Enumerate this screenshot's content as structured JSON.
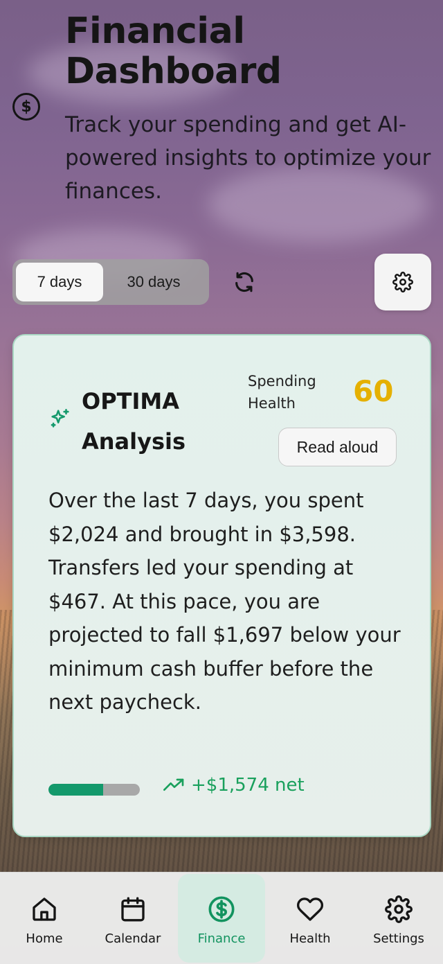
{
  "header": {
    "title": "Financial Dashboard",
    "subtitle": "Track your spending and get AI-powered insights to optimize your finances.",
    "logo_icon": "dollar-circle-icon"
  },
  "controls": {
    "range_options": [
      "7 days",
      "30 days"
    ],
    "selected_range": "7 days",
    "refresh_icon": "refresh-icon",
    "settings_icon": "gear-icon"
  },
  "analysis": {
    "icon": "sparkles-icon",
    "title": "OPTIMA Analysis",
    "health_label": "Spending Health",
    "health_score": "60",
    "read_aloud_label": "Read aloud",
    "text": "Over the last 7 days, you spent $2,024 and brought in $3,598. Transfers led your spending at $467. At this pace, you are projected to fall $1,697 below your minimum cash buffer before the next paycheck.",
    "progress_fraction": 0.6,
    "net_icon": "trending-up-icon",
    "net_label": "+$1,574 net"
  },
  "nav": {
    "items": [
      {
        "label": "Home",
        "icon": "home-icon"
      },
      {
        "label": "Calendar",
        "icon": "calendar-icon"
      },
      {
        "label": "Finance",
        "icon": "dollar-circle-icon"
      },
      {
        "label": "Health",
        "icon": "heart-icon"
      },
      {
        "label": "Settings",
        "icon": "gear-icon"
      }
    ],
    "active": "Finance"
  },
  "colors": {
    "accent": "#13996b",
    "score": "#e5b000",
    "net_positive": "#19a05c",
    "card_bg": "#e3f1ec"
  }
}
